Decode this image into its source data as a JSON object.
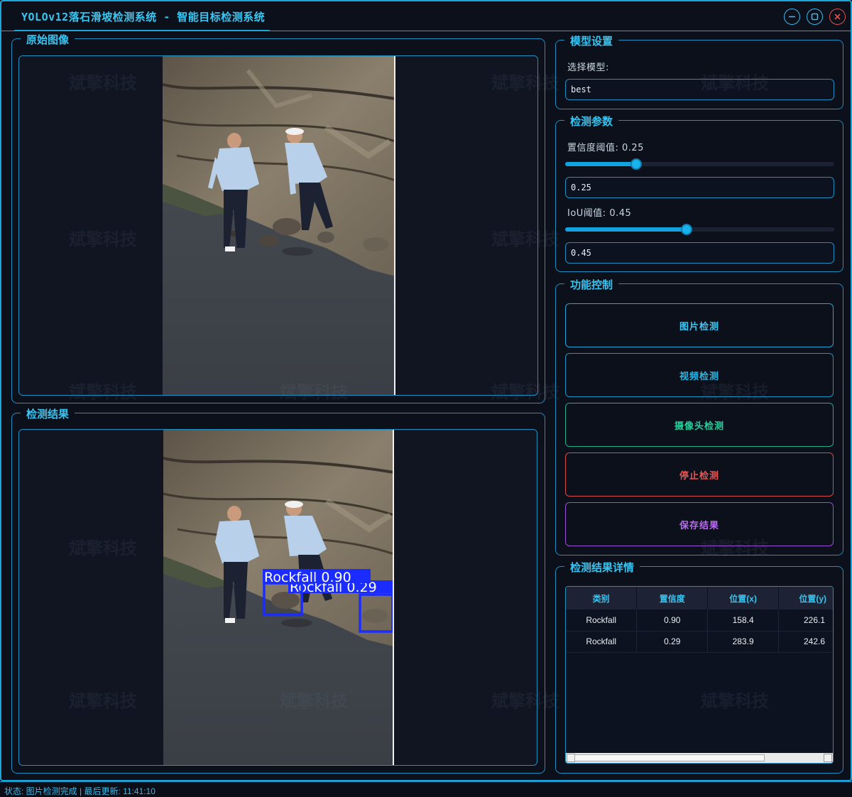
{
  "window": {
    "title": "YOLOv12落石滑坡检测系统 - 智能目标检测系统",
    "buttons": [
      "minimize",
      "maximize",
      "close"
    ]
  },
  "panels": {
    "original": {
      "title": "原始图像"
    },
    "result": {
      "title": "检测结果",
      "boxes": [
        {
          "label": "Rockfall 0.90",
          "color": "#1a2cff"
        },
        {
          "label": "Rockfall 0.29",
          "color": "#1a2cff"
        }
      ]
    }
  },
  "model_settings": {
    "title": "模型设置",
    "select_label": "选择模型:",
    "selected_model": "best"
  },
  "detection_params": {
    "title": "检测参数",
    "confidence_label": "置信度阈值: 0.25",
    "confidence_value": "0.25",
    "confidence_slider": 0.25,
    "iou_label": "IoU阈值: 0.45",
    "iou_value": "0.45",
    "iou_slider": 0.45
  },
  "controls": {
    "title": "功能控制",
    "image_detect": "图片检测",
    "video_detect": "视频检测",
    "camera_detect": "摄像头检测",
    "stop_detect": "停止检测",
    "save_result": "保存结果"
  },
  "results_table": {
    "title": "检测结果详情",
    "columns": [
      "类别",
      "置信度",
      "位置(x)",
      "位置(y)"
    ],
    "rows": [
      [
        "Rockfall",
        "0.90",
        "158.4",
        "226.1"
      ],
      [
        "Rockfall",
        "0.29",
        "283.9",
        "242.6"
      ]
    ]
  },
  "status_bar": {
    "text": "状态: 图片检测完成 | 最后更新: 11:41:10"
  },
  "watermark": "斌擎科技",
  "colors": {
    "accent": "#1aa6d8",
    "background": "#0c101b",
    "green": "#28d09d",
    "red": "#ef5350",
    "purple": "#b86af0"
  }
}
